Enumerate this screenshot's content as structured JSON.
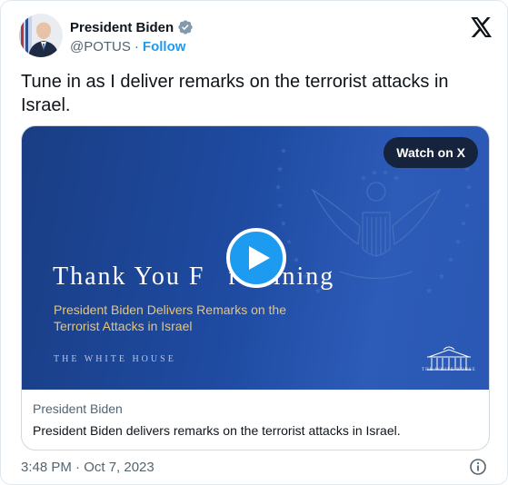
{
  "author": {
    "name": "President Biden",
    "handle": "@POTUS",
    "separator": "·",
    "follow_label": "Follow",
    "verified_icon": "verified-badge-icon"
  },
  "tweet": {
    "text": "Tune in as I deliver remarks on the terrorist attacks in Israel.",
    "timestamp": "3:48 PM · Oct 7, 2023"
  },
  "video": {
    "watch_label": "Watch on X",
    "headline_part1": "Thank You F",
    "headline_part2": "r Joining",
    "subtitle": "President Biden Delivers Remarks on the Terrorist Attacks in Israel",
    "branding": "THE WHITE HOUSE",
    "logo_caption": "THE WHITE HOUSE"
  },
  "card": {
    "author": "President Biden",
    "description": "President Biden delivers remarks on the terrorist attacks in Israel."
  },
  "colors": {
    "accent": "#1d9bf0",
    "video_bg": "#1e4aa0",
    "subtitle_gold": "#e8c577"
  }
}
